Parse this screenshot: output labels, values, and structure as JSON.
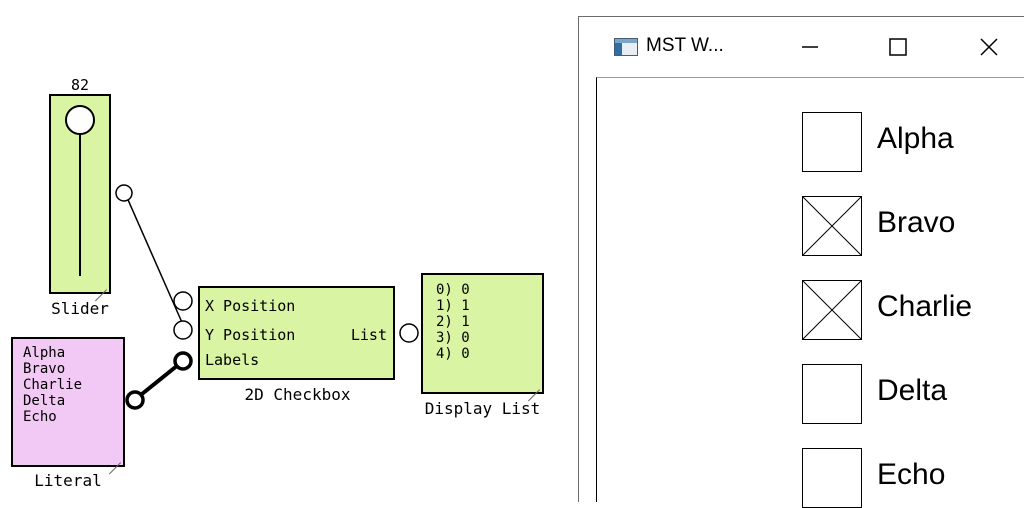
{
  "slider": {
    "value": "82",
    "label": "Slider",
    "level": 0.82
  },
  "literal": {
    "label": "Literal",
    "lines": [
      "Alpha",
      "Bravo",
      "Charlie",
      "Delta",
      "Echo"
    ]
  },
  "checkbox_block": {
    "label": "2D Checkbox",
    "ports": {
      "x": "X Position",
      "y": "Y Position",
      "labels": "Labels",
      "output": "List"
    }
  },
  "display_list": {
    "label": "Display List",
    "lines": [
      "0) 0",
      "1) 1",
      "2) 1",
      "3) 0",
      "4) 0"
    ]
  },
  "window": {
    "title": "MST W...",
    "minimize_icon": "minimize-icon",
    "maximize_icon": "maximize-icon",
    "close_icon": "close-icon",
    "checkboxes": [
      {
        "label": "Alpha",
        "checked": false
      },
      {
        "label": "Bravo",
        "checked": true
      },
      {
        "label": "Charlie",
        "checked": true
      },
      {
        "label": "Delta",
        "checked": false
      },
      {
        "label": "Echo",
        "checked": false
      }
    ]
  },
  "colors": {
    "block_green": "#d9f5a3",
    "block_pink": "#f2c8f4"
  }
}
